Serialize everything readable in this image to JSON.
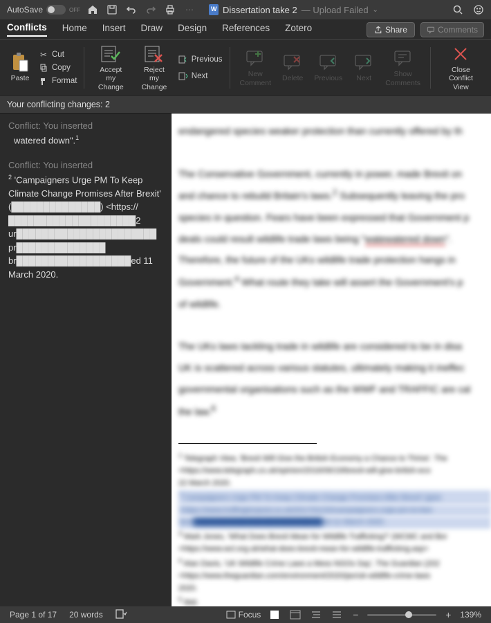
{
  "titlebar": {
    "autosave_label": "AutoSave",
    "autosave_state": "OFF",
    "doc_name": "Dissertation take 2",
    "upload_status": "— Upload Failed"
  },
  "tabs": {
    "items": [
      "Conflicts",
      "Home",
      "Insert",
      "Draw",
      "Design",
      "References",
      "Zotero"
    ],
    "active_index": 0,
    "share": "Share",
    "comments": "Comments"
  },
  "ribbon": {
    "paste": "Paste",
    "cut": "Cut",
    "copy": "Copy",
    "format": "Format",
    "accept": "Accept my\nChange",
    "reject": "Reject my\nChange",
    "previous": "Previous",
    "next": "Next",
    "new_comment": "New\nComment",
    "delete": "Delete",
    "previous2": "Previous",
    "next2": "Next",
    "show_comments": "Show\nComments",
    "close_view": "Close\nConflict View"
  },
  "conflict_bar": "Your conflicting changes: 2",
  "sidebar": {
    "items": [
      {
        "head": "Conflict: You inserted",
        "body": "watered down\".",
        "sup": "1"
      },
      {
        "head": "Conflict: You inserted",
        "body_sup": "2",
        "body": " 'Campaigners Urge PM To Keep Climate Change Promises After Brexit' (██████████████) <https://████████████████████2 ur██████████████████████ pr██████████████ br██████████████████ed 11 March 2020."
      }
    ]
  },
  "statusbar": {
    "page": "Page 1 of 17",
    "words": "20 words",
    "focus": "Focus",
    "zoom": "139%"
  }
}
